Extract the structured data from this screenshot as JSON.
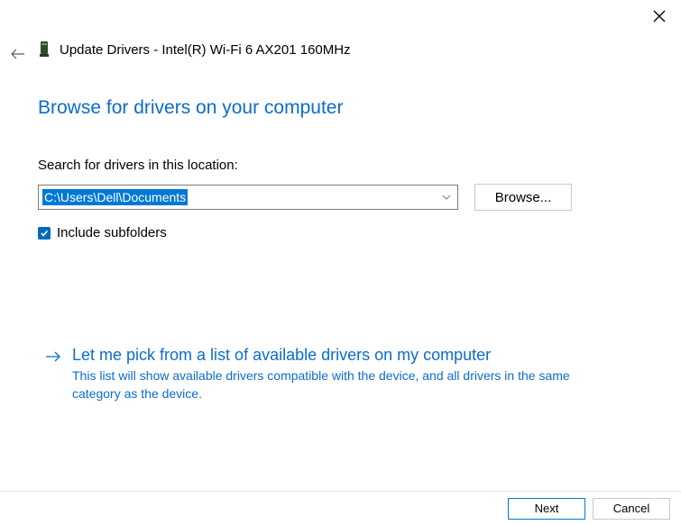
{
  "header": {
    "title": "Update Drivers - Intel(R) Wi-Fi 6 AX201 160MHz"
  },
  "main": {
    "heading": "Browse for drivers on your computer",
    "search_label": "Search for drivers in this location:",
    "path_value": "C:\\Users\\Dell\\Documents",
    "browse_label": "Browse...",
    "include_subfolders_label": "Include subfolders",
    "include_subfolders_checked": true
  },
  "pick_option": {
    "title": "Let me pick from a list of available drivers on my computer",
    "description": "This list will show available drivers compatible with the device, and all drivers in the same category as the device."
  },
  "footer": {
    "next_label": "Next",
    "cancel_label": "Cancel"
  }
}
